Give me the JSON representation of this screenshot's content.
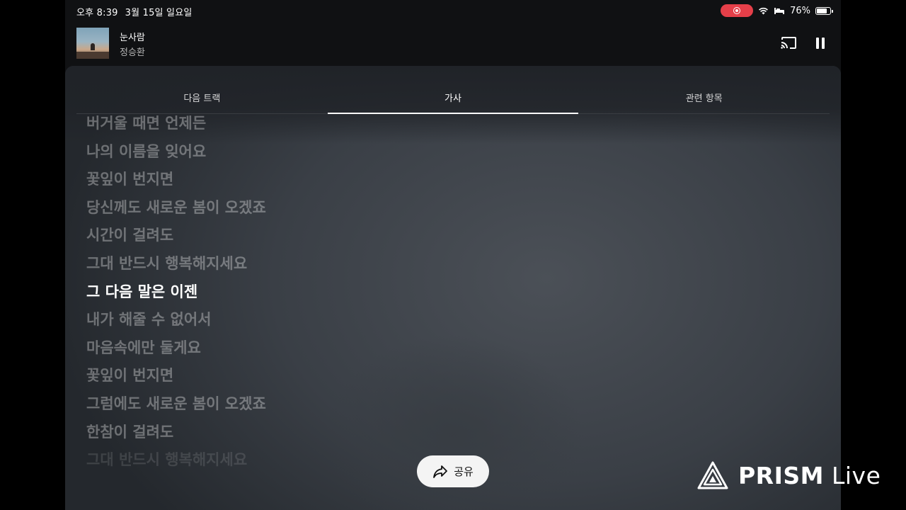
{
  "status_bar": {
    "time": "오후 8:39",
    "date": "3월 15일 일요일",
    "battery": "76%",
    "battery_level": 0.76,
    "recording_color": "#e53f49"
  },
  "now_playing": {
    "title": "눈사람",
    "artist": "정승환",
    "cast_icon": "cast-icon",
    "pause_icon": "pause-icon"
  },
  "tabs": [
    {
      "label": "다음 트랙",
      "active": false
    },
    {
      "label": "가사",
      "active": true
    },
    {
      "label": "관련 항목",
      "active": false
    }
  ],
  "lyrics": {
    "lines": [
      "버거울 때면 언제든",
      "나의 이름을 잊어요",
      "꽃잎이 번지면",
      "당신께도 새로운 봄이 오겠죠",
      "시간이 걸려도",
      "그대 반드시 행복해지세요",
      "그 다음 말은 이젠",
      "내가 해줄 수 없어서",
      "마음속에만 둘게요",
      "꽃잎이 번지면",
      "그럼에도 새로운 봄이 오겠죠",
      "한참이 걸려도",
      "그대 반드시 행복해지세요"
    ],
    "current_index": 6
  },
  "share": {
    "label": "공유"
  },
  "watermark": {
    "brand": "PRISM",
    "suffix": "Live"
  }
}
